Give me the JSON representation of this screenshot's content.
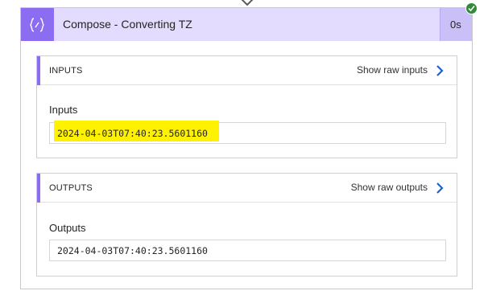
{
  "action": {
    "title": "Compose - Converting TZ",
    "duration": "0s",
    "icon": "compose-braces-icon",
    "status_icon": "success-check-icon"
  },
  "inputs": {
    "section_title": "INPUTS",
    "raw_link": "Show raw inputs",
    "field_label": "Inputs",
    "value": "2024-04-03T07:40:23.5601160"
  },
  "outputs": {
    "section_title": "OUTPUTS",
    "raw_link": "Show raw outputs",
    "field_label": "Outputs",
    "value": "2024-04-03T07:40:23.5601160"
  },
  "colors": {
    "accent": "#8c6cf1",
    "header_bg": "#e3dcff",
    "highlight": "#fff200",
    "success": "#2f8a3a",
    "link_chevron": "#1a62d6"
  }
}
